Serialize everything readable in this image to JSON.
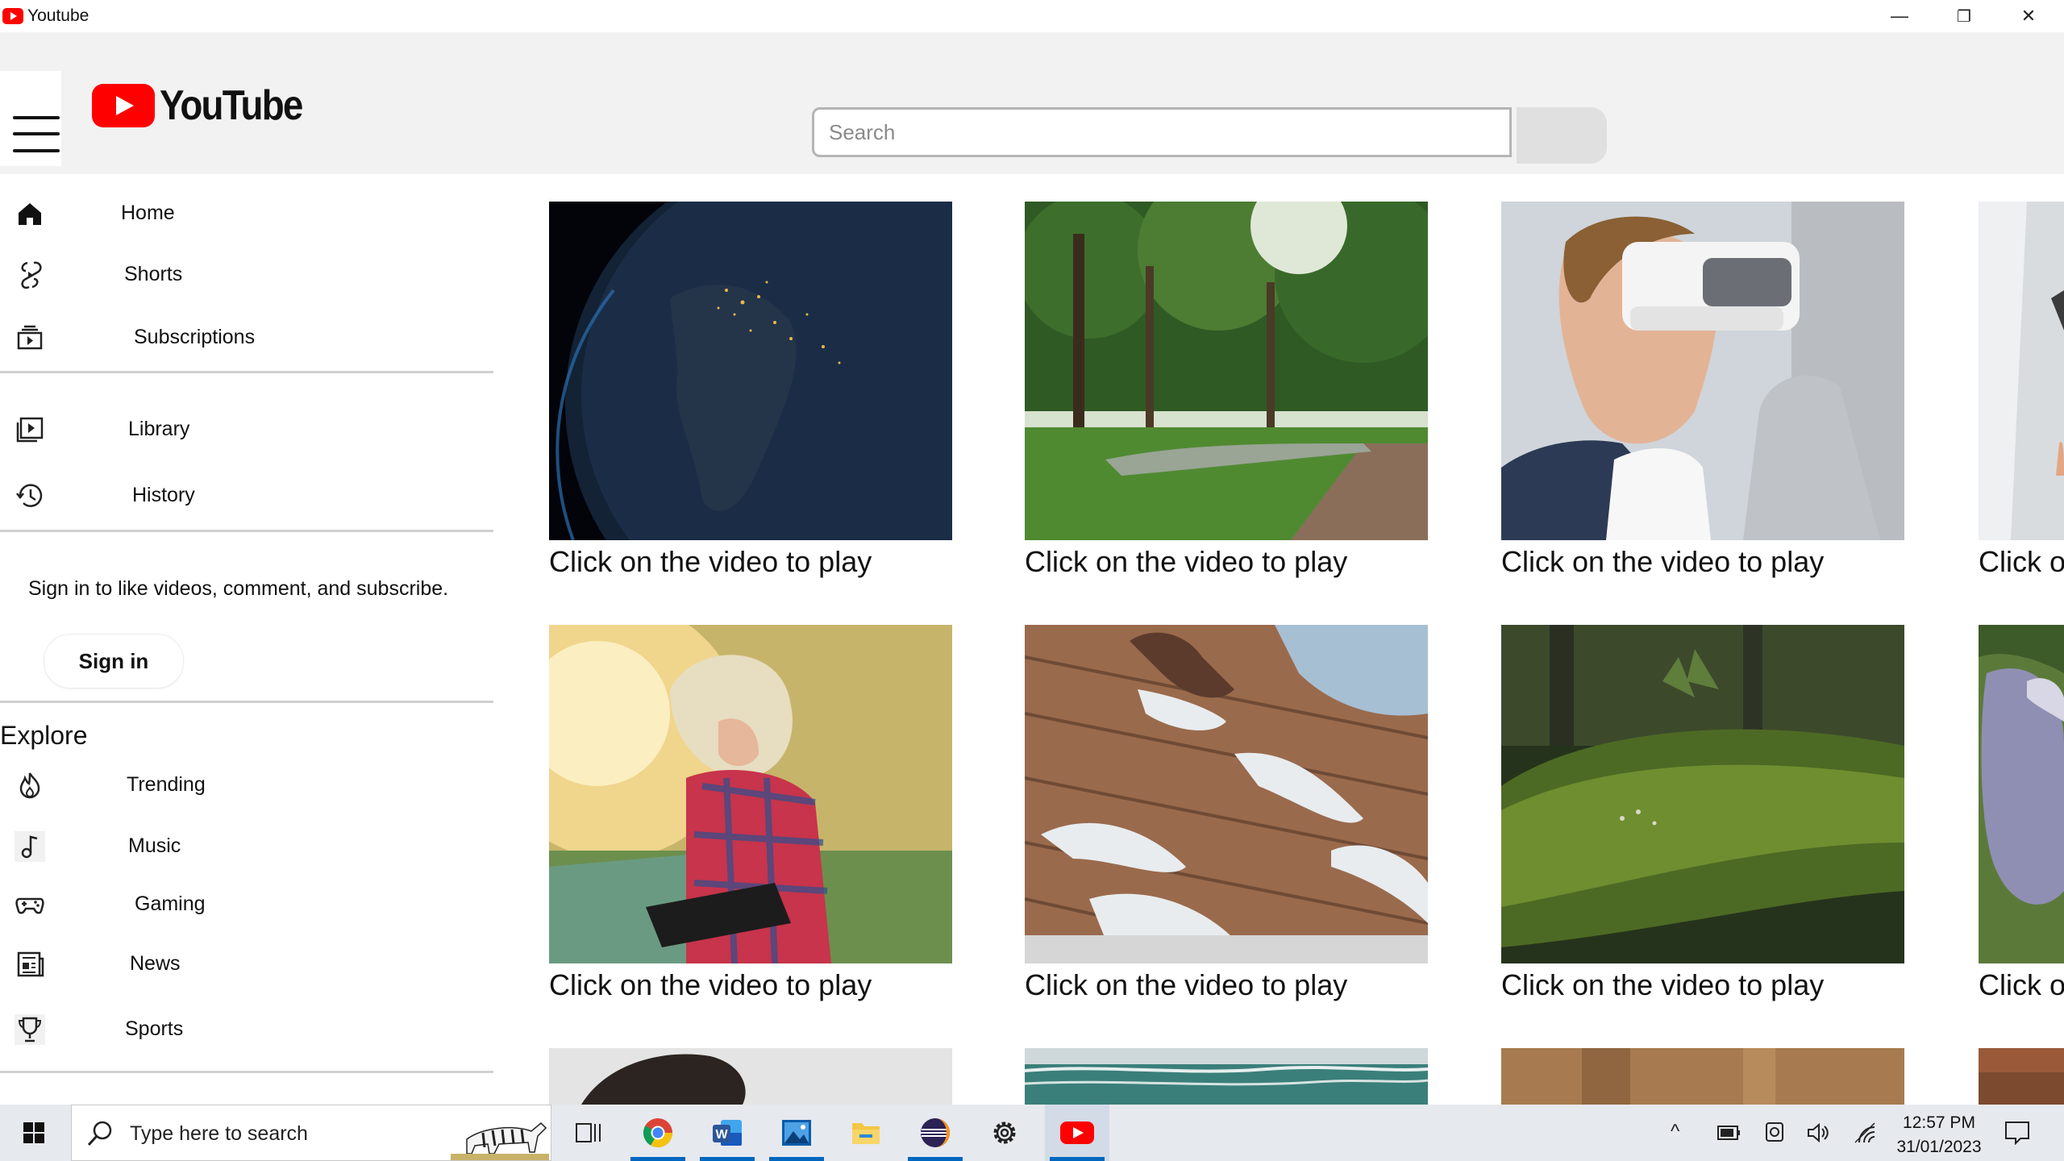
{
  "window": {
    "title": "Youtube",
    "minimize": "—",
    "restore": "❐",
    "close": "✕"
  },
  "header": {
    "logo_text": "YouTube",
    "search": {
      "placeholder": "Search",
      "value": ""
    }
  },
  "sidebar": {
    "primary": [
      {
        "label": "Home",
        "icon": "home-icon"
      },
      {
        "label": "Shorts",
        "icon": "shorts-icon"
      },
      {
        "label": "Subscriptions",
        "icon": "subscriptions-icon"
      }
    ],
    "library": [
      {
        "label": "Library",
        "icon": "library-icon"
      },
      {
        "label": "History",
        "icon": "history-icon"
      }
    ],
    "signin_prompt": "Sign in to like videos, comment, and subscribe.",
    "signin_button": "Sign in",
    "explore_title": "Explore",
    "explore": [
      {
        "label": "Trending",
        "icon": "trending-icon"
      },
      {
        "label": "Music",
        "icon": "music-icon"
      },
      {
        "label": "Gaming",
        "icon": "gaming-icon"
      },
      {
        "label": "News",
        "icon": "news-icon"
      },
      {
        "label": "Sports",
        "icon": "sports-icon"
      }
    ]
  },
  "videos": [
    {
      "caption": "Click on the video to play",
      "thumbnail": "earth-at-night"
    },
    {
      "caption": "Click on the video to play",
      "thumbnail": "park-trees"
    },
    {
      "caption": "Click on the video to play",
      "thumbnail": "child-vr-headset"
    },
    {
      "caption": "Click o",
      "thumbnail": "partial"
    },
    {
      "caption": "Click on the video to play",
      "thumbnail": "woman-with-tablet"
    },
    {
      "caption": "Click on the video to play",
      "thumbnail": "wooden-letters"
    },
    {
      "caption": "Click on the video to play",
      "thumbnail": "mossy-log"
    },
    {
      "caption": "Click o",
      "thumbnail": "partial-animal"
    }
  ],
  "taskbar": {
    "search_placeholder": "Type here to search",
    "time": "12:57 PM",
    "date": "31/01/2023",
    "apps": [
      "task-view-icon",
      "chrome-icon",
      "word-icon",
      "photos-icon",
      "file-explorer-icon",
      "eclipse-icon",
      "settings-icon",
      "youtube-icon"
    ]
  },
  "colors": {
    "brand_red": "#ff0000",
    "header_bg": "#f2f2f2",
    "taskbar_bg": "#e6e9ee",
    "accent": "#0067c0"
  }
}
